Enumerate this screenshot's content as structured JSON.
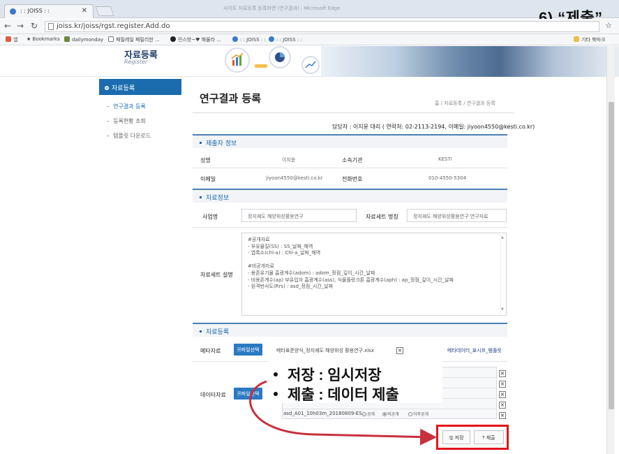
{
  "browser": {
    "tab_title": ": : JOISS : :",
    "window_title": "사이트 자료등록 등록화면 (연구결과) - Microsoft Edge",
    "url": "joiss.kr/joiss/rgst.register.Add.do",
    "bookmarks": [
      "앱",
      "Bookmarks",
      "dailymonday",
      "패밀레일 패밀리한 ...",
      "민스방~♥ 해물라 ...",
      ": : JOISS : :",
      ": : JOISS : :",
      "기타 북마크"
    ],
    "close_label": "✕"
  },
  "step_label": "6) “제출”",
  "header": {
    "title": "자료등록",
    "subtitle": "Register"
  },
  "sidebar": {
    "heading": "자료등록",
    "items": [
      "연구결과 등록",
      "등록현황 조회",
      "템플릿 다운로드"
    ]
  },
  "main": {
    "title": "연구결과 등록",
    "breadcrumb": "홈 / 자료등록 / 연구결과 등록",
    "contact": "담당자 : 이지윤 대리 ( 연락처: 02-2113-2194, 이메일: jiyoon4550@kesti.co.kr)"
  },
  "submitter": {
    "section": "제출자 정보",
    "name_label": "성명",
    "name_value": "이지윤",
    "org_label": "소속기관",
    "org_value": "KESTI",
    "email_label": "이메일",
    "email_value": "jiyoon4550@kesti.co.kr",
    "phone_label": "전화번호",
    "phone_value": "010-4550-5304"
  },
  "data_info": {
    "section": "자료정보",
    "project_label": "사업명",
    "project_value": "정지궤도 해양위성활용연구",
    "dataset_label": "자료세트 명칭",
    "dataset_value": "정지궤도 해양위성활용연구 연구자료",
    "desc_label": "자료세트 설명",
    "desc_lines": [
      "#공개자료",
      "- 부유물질(SS) : SS_날짜_해역",
      "- 엽록소(chl-a) : Chl-a_날짜_해역",
      "",
      "#비공개자료",
      "- 용존유기물 흡광계수(adom) : adom_정점_깊이_시간_날짜",
      "- 비용존계수(ap) 부유입자 흡광계수(ass), 식물플랑크톤 흡광계수(aph) : ap_정점_깊이_시간_날짜",
      "- 원격반사도(Rrs) : asd_정점_시간_날짜"
    ]
  },
  "registration": {
    "section": "자료등록",
    "meta_label": "메타자료",
    "data_label": "데이터자료",
    "file_button": "파일선택",
    "meta_file": "메타표준양식_정지궤도 해양위성 활용연구.xlsx",
    "meta_link": "메타데이터_표시프_템플릿",
    "data_file": "asd_A01_10h03m_20180809-ES...",
    "radio_public": "공개",
    "radio_private": "비공개",
    "radio_later": "이후공개"
  },
  "actions": {
    "save": "저장",
    "submit": "제출"
  },
  "callout": {
    "line1": "저장 : 임시저장",
    "line2": "제출 : 데이터 제출"
  },
  "colors": {
    "accent": "#1a6cae",
    "highlight": "#e3141b",
    "arrow": "#c8303f"
  }
}
